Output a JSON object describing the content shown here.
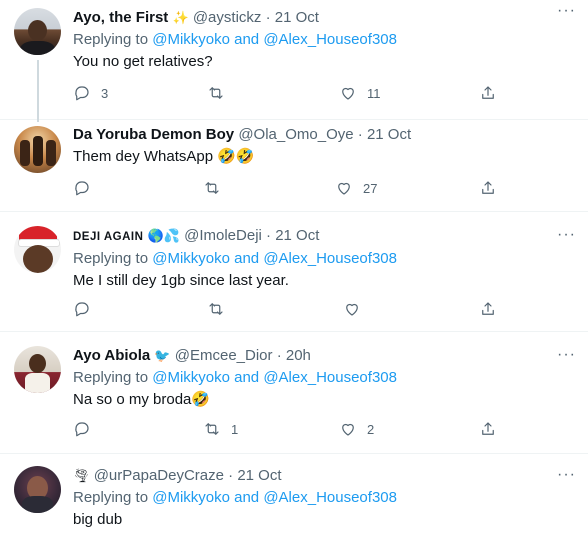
{
  "tweets": [
    {
      "name": "Ayo, the First",
      "name_emoji": "✨",
      "handle": "@aystickz",
      "sep": "·",
      "date": "21 Oct",
      "replying_prefix": "Replying to",
      "replying_to": "@Mikkyoko and @Alex_Houseof308",
      "text": "You no get relatives?",
      "counts": {
        "reply": "3",
        "retweet": "",
        "like": "11"
      },
      "avatar_icon": "user-avatar"
    },
    {
      "name": "Da Yoruba Demon Boy",
      "handle": "@Ola_Omo_Oye",
      "sep": "·",
      "date": "21 Oct",
      "text": "Them dey WhatsApp 🤣🤣",
      "counts": {
        "reply": "",
        "retweet": "",
        "like": "27"
      },
      "avatar_icon": "user-avatar"
    },
    {
      "name": "DEJI AGAIN",
      "name_emoji": "🌎💦",
      "handle": "@ImoleDeji",
      "sep": "·",
      "date": "21 Oct",
      "replying_prefix": "Replying to",
      "replying_to": "@Mikkyoko and @Alex_Houseof308",
      "text": "Me I still dey 1gb since last year.",
      "counts": {
        "reply": "",
        "retweet": "",
        "like": ""
      },
      "avatar_icon": "user-avatar"
    },
    {
      "name": "Ayo Abiola",
      "name_emoji": "🐦",
      "handle": "@Emcee_Dior",
      "sep": "·",
      "date": "20h",
      "replying_prefix": "Replying to",
      "replying_to": "@Mikkyoko and @Alex_Houseof308",
      "text": "Na so o my broda🤣",
      "counts": {
        "reply": "",
        "retweet": "1",
        "like": "2"
      },
      "avatar_icon": "user-avatar"
    },
    {
      "name": "",
      "name_emoji": "🌪",
      "handle": "@urPapaDeyCraze",
      "sep": "·",
      "date": "21 Oct",
      "replying_prefix": "Replying to",
      "replying_to": "@Mikkyoko and @Alex_Houseof308",
      "text": "big dub",
      "avatar_icon": "user-avatar"
    }
  ],
  "more_label": "···",
  "colors": {
    "link": "#1d9bf0",
    "muted": "#536471",
    "text": "#0f1419",
    "divider": "#eff3f4"
  }
}
